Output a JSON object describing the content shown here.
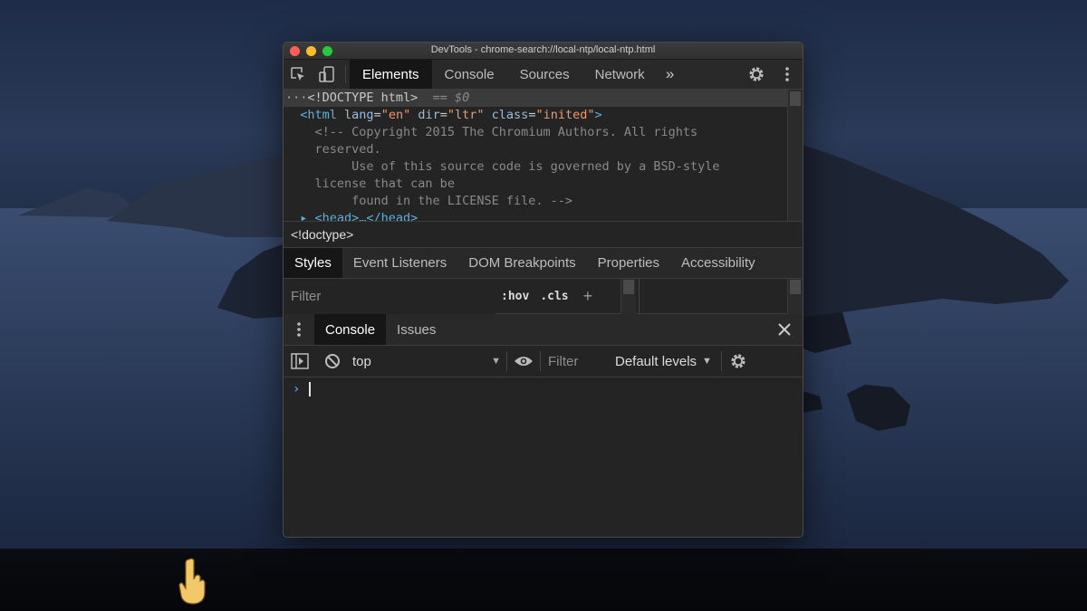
{
  "window": {
    "title": "DevTools - chrome-search://local-ntp/local-ntp.html"
  },
  "main_tabs": [
    {
      "label": "Elements",
      "active": true
    },
    {
      "label": "Console",
      "active": false
    },
    {
      "label": "Sources",
      "active": false
    },
    {
      "label": "Network",
      "active": false
    }
  ],
  "main_more": "»",
  "dom": {
    "line1": {
      "dots": "···",
      "text": "<!DOCTYPE html>",
      "eq": " == $0"
    },
    "line2": {
      "open": "<html",
      "attr1": "lang",
      "val1": "\"en\"",
      "attr2": "dir",
      "val2": "\"ltr\"",
      "attr3": "class",
      "val3": "\"inited\"",
      "close": ">"
    },
    "comment_lines": [
      "<!-- Copyright 2015 The Chromium Authors. All rights",
      "reserved.",
      "     Use of this source code is governed by a BSD-style",
      "license that can be",
      "     found in the LICENSE file. -->"
    ],
    "line_partial": "▸ <head>…</head>"
  },
  "breadcrumb": "<!doctype>",
  "sub_tabs": [
    {
      "label": "Styles",
      "active": true
    },
    {
      "label": "Event Listeners",
      "active": false
    },
    {
      "label": "DOM Breakpoints",
      "active": false
    },
    {
      "label": "Properties",
      "active": false
    },
    {
      "label": "Accessibility",
      "active": false
    }
  ],
  "styles_filter": {
    "placeholder": "Filter",
    "hov": ":hov",
    "cls": ".cls",
    "plus": "+"
  },
  "drawer_tabs": [
    {
      "label": "Console",
      "active": true
    },
    {
      "label": "Issues",
      "active": false
    }
  ],
  "console_toolbar": {
    "context": "top",
    "filter_placeholder": "Filter",
    "levels": "Default levels"
  },
  "console": {
    "prompt": "›"
  },
  "icons": {
    "inspect": "inspect-element-icon",
    "device": "device-toolbar-icon",
    "settings": "gear-icon",
    "kebab": "kebab-menu-icon",
    "close": "close-icon",
    "sidebar": "sidebar-toggle-icon",
    "clear": "clear-console-icon",
    "eye": "eye-icon"
  },
  "colors": {
    "active_tab_bg": "#161616",
    "tag": "#5db0d7",
    "attr_value": "#f29766",
    "prompt": "#4a9fe8"
  }
}
